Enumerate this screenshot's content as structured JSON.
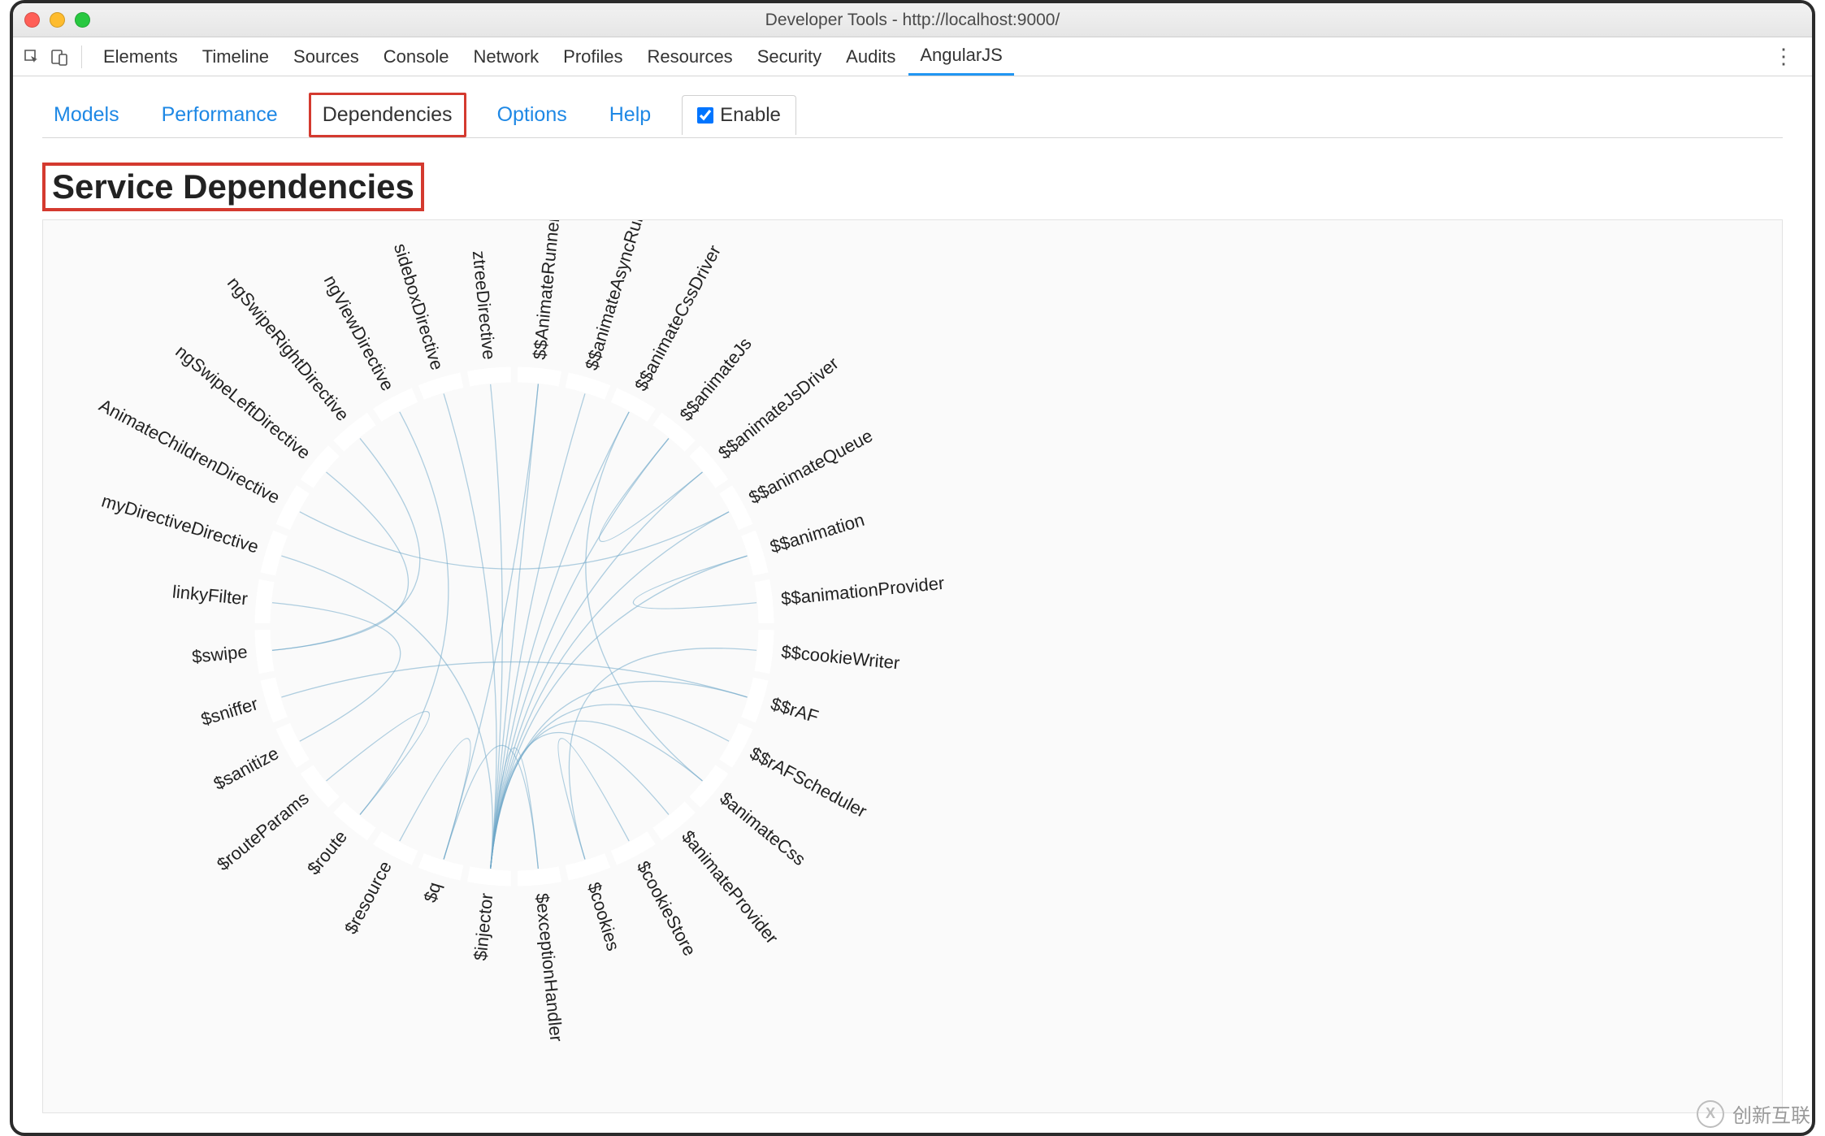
{
  "window": {
    "title": "Developer Tools - http://localhost:9000/"
  },
  "main_tabs": {
    "items": [
      "Elements",
      "Timeline",
      "Sources",
      "Console",
      "Network",
      "Profiles",
      "Resources",
      "Security",
      "Audits",
      "AngularJS"
    ],
    "active": "AngularJS"
  },
  "sub_tabs": {
    "items": [
      "Models",
      "Performance",
      "Dependencies",
      "Options",
      "Help"
    ],
    "active": "Dependencies",
    "enable_label": "Enable",
    "enable_checked": true
  },
  "page": {
    "heading": "Service Dependencies"
  },
  "watermark": {
    "text": "创新互联"
  },
  "chart_data": {
    "type": "chord",
    "title": "Service Dependencies",
    "nodes": [
      "$$AnimateRunner",
      "$$animateAsyncRun",
      "$$animateCssDriver",
      "$$animateJs",
      "$$animateJsDriver",
      "$$animateQueue",
      "$$animation",
      "$$animationProvider",
      "$$cookieWriter",
      "$$rAF",
      "$$rAFScheduler",
      "$animateCss",
      "$animateProvider",
      "$cookieStore",
      "$cookies",
      "$exceptionHandler",
      "$injector",
      "$q",
      "$resource",
      "$route",
      "$routeParams",
      "$sanitize",
      "$sniffer",
      "$swipe",
      "linkyFilter",
      "myDirectiveDirective",
      "AnimateChildrenDirective",
      "ngSwipeLeftDirective",
      "ngSwipeRightDirective",
      "ngViewDirective",
      "sideboxDirective",
      "ztreeDirective"
    ],
    "edges": [
      [
        "$injector",
        "$$AnimateRunner"
      ],
      [
        "$injector",
        "$$animateAsyncRun"
      ],
      [
        "$injector",
        "$$animateCssDriver"
      ],
      [
        "$injector",
        "$$animateJs"
      ],
      [
        "$injector",
        "$$animateJsDriver"
      ],
      [
        "$injector",
        "$$animateQueue"
      ],
      [
        "$injector",
        "$$animation"
      ],
      [
        "$injector",
        "$$rAF"
      ],
      [
        "$injector",
        "$$rAFScheduler"
      ],
      [
        "$injector",
        "$animateCss"
      ],
      [
        "$injector",
        "$animateProvider"
      ],
      [
        "$exceptionHandler",
        "$q"
      ],
      [
        "$exceptionHandler",
        "$injector"
      ],
      [
        "$q",
        "$resource"
      ],
      [
        "$q",
        "$$AnimateRunner"
      ],
      [
        "$cookies",
        "$cookieStore"
      ],
      [
        "$cookies",
        "$$cookieWriter"
      ],
      [
        "$route",
        "$routeParams"
      ],
      [
        "$route",
        "ngViewDirective"
      ],
      [
        "$swipe",
        "ngSwipeLeftDirective"
      ],
      [
        "$swipe",
        "ngSwipeRightDirective"
      ],
      [
        "$sanitize",
        "linkyFilter"
      ],
      [
        "ztreeDirective",
        "$injector"
      ],
      [
        "sideboxDirective",
        "$injector"
      ],
      [
        "myDirectiveDirective",
        "$injector"
      ],
      [
        "AnimateChildrenDirective",
        "$$animateQueue"
      ],
      [
        "$$animationProvider",
        "$$animation"
      ],
      [
        "$$animateCssDriver",
        "$animateCss"
      ],
      [
        "$$animateJsDriver",
        "$$animateJs"
      ],
      [
        "$sniffer",
        "$$rAF"
      ]
    ]
  }
}
